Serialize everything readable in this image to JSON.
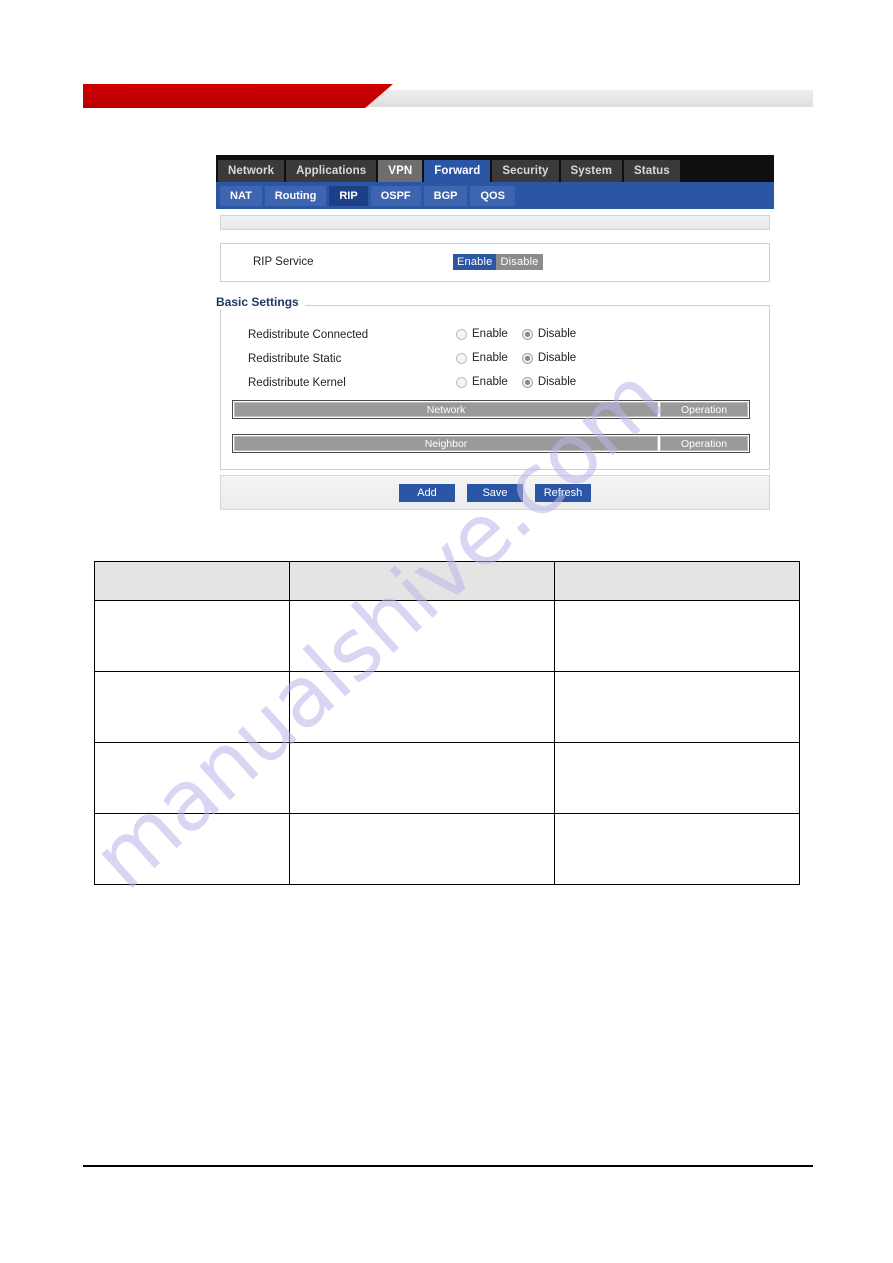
{
  "header": {
    "banner_red": "#c50000",
    "banner_gray": "#e6e6e6"
  },
  "router_ui": {
    "main_tabs": [
      {
        "label": "Network",
        "state": "normal"
      },
      {
        "label": "Applications",
        "state": "normal"
      },
      {
        "label": "VPN",
        "state": "lighter"
      },
      {
        "label": "Forward",
        "state": "active"
      },
      {
        "label": "Security",
        "state": "normal"
      },
      {
        "label": "System",
        "state": "normal"
      },
      {
        "label": "Status",
        "state": "normal"
      }
    ],
    "sub_tabs": [
      {
        "label": "NAT",
        "state": "normal"
      },
      {
        "label": "Routing",
        "state": "normal"
      },
      {
        "label": "RIP",
        "state": "active"
      },
      {
        "label": "OSPF",
        "state": "normal"
      },
      {
        "label": "BGP",
        "state": "normal"
      },
      {
        "label": "QOS",
        "state": "normal"
      }
    ],
    "service": {
      "label": "RIP Service",
      "enable_label": "Enable",
      "disable_label": "Disable",
      "selected": "Enable"
    },
    "basic_settings": {
      "legend": "Basic Settings",
      "rows": [
        {
          "label": "Redistribute Connected",
          "enable_label": "Enable",
          "disable_label": "Disable",
          "selected": "Disable"
        },
        {
          "label": "Redistribute Static",
          "enable_label": "Enable",
          "disable_label": "Disable",
          "selected": "Disable"
        },
        {
          "label": "Redistribute Kernel",
          "enable_label": "Enable",
          "disable_label": "Disable",
          "selected": "Disable"
        }
      ],
      "lists": [
        {
          "title": "Network",
          "operation": "Operation"
        },
        {
          "title": "Neighbor",
          "operation": "Operation"
        }
      ]
    },
    "actions": [
      {
        "label": "Add"
      },
      {
        "label": "Save"
      },
      {
        "label": "Refresh"
      }
    ],
    "accent_blue": "#2b56a5"
  },
  "desc_table": {
    "header": [
      "",
      "",
      ""
    ],
    "rows": [
      [
        "",
        "",
        ""
      ],
      [
        "",
        "",
        ""
      ],
      [
        "",
        "",
        ""
      ],
      [
        "",
        "",
        ""
      ]
    ]
  },
  "watermark": {
    "text": "manualshive.com",
    "color": "#b9b6e8"
  }
}
